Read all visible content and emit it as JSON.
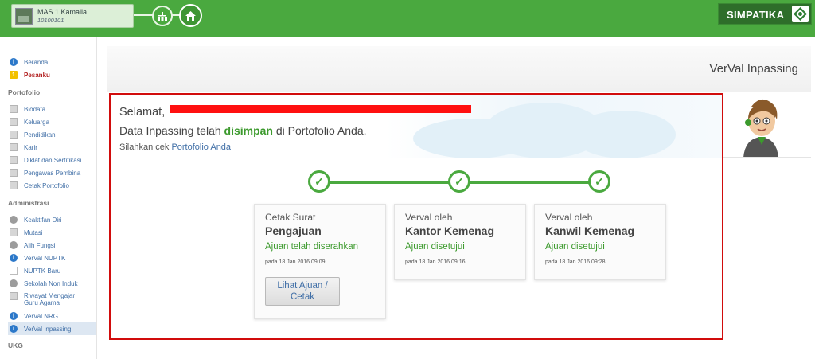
{
  "topbar": {
    "school_name": "MAS 1 Kamalia",
    "school_npsn": "10100101",
    "brand": "SIMPATIKA",
    "icons": [
      "tree-structure-icon",
      "home-icon"
    ]
  },
  "sidebar": {
    "top_items": [
      {
        "label": "Beranda",
        "icon": "info-icon"
      },
      {
        "label": "Pesanku",
        "icon": "mail-icon",
        "badge": "1"
      }
    ],
    "sections": [
      {
        "heading": "Portofolio",
        "items": [
          "Biodata",
          "Keluarga",
          "Pendidikan",
          "Karir",
          "Diklat dan Sertifikasi",
          "Pengawas Pembina",
          "Cetak Portofolio"
        ]
      },
      {
        "heading": "Administrasi",
        "items": [
          "Keaktifan Diri",
          "Mutasi",
          "Alih Fungsi",
          "VerVal NUPTK",
          "NUPTK Baru",
          "Sekolah Non Induk",
          "Riwayat Mengajar Guru Agama",
          "VerVal NRG",
          "VerVal Inpassing"
        ]
      },
      {
        "heading": "UKG",
        "items": []
      }
    ],
    "active": "VerVal Inpassing"
  },
  "page": {
    "title": "VerVal Inpassing"
  },
  "welcome": {
    "greeting": "Selamat,",
    "line2_prefix": "Data Inpassing telah ",
    "line2_bold": "disimpan",
    "line2_suffix": " di Portofolio Anda.",
    "line3_prefix": "Silahkan cek ",
    "line3_link": "Portofolio Anda"
  },
  "steps": [
    {
      "title": "Cetak Surat",
      "subtitle": "Pengajuan",
      "status": "Ajuan telah diserahkan",
      "date": "pada 18 Jan 2016 09:09",
      "button": "Lihat Ajuan / Cetak"
    },
    {
      "title": "Verval oleh",
      "subtitle": "Kantor Kemenag",
      "status": "Ajuan disetujui",
      "date": "pada 18 Jan 2016 09:16"
    },
    {
      "title": "Verval oleh",
      "subtitle": "Kanwil Kemenag",
      "status": "Ajuan disetujui",
      "date": "pada 18 Jan 2016 09:28"
    }
  ],
  "colors": {
    "primary_green": "#4aa93f",
    "highlight_red": "#d10c0c",
    "link_blue": "#3f6ea6"
  }
}
